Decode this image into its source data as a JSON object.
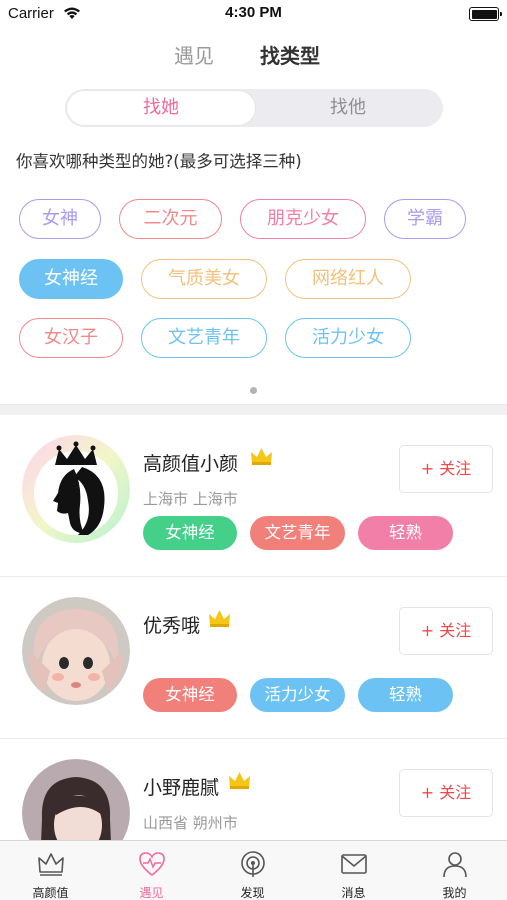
{
  "status_bar": {
    "carrier": "Carrier",
    "time": "4:30 PM"
  },
  "top_tabs": {
    "inactive": "遇见",
    "active": "找类型"
  },
  "segment": {
    "left": "找她",
    "right": "找他"
  },
  "question": "你喜欢哪种类型的她?(最多可选择三种)",
  "type_tags": [
    {
      "label": "女神",
      "color": "#a99cf0",
      "selected": false
    },
    {
      "label": "二次元",
      "color": "#f08a8a",
      "selected": false
    },
    {
      "label": "朋克少女",
      "color": "#f27fa8",
      "selected": false
    },
    {
      "label": "学霸",
      "color": "#a99cf0",
      "selected": false
    },
    {
      "label": "女神经",
      "color": "#6cc3f3",
      "selected": true
    },
    {
      "label": "气质美女",
      "color": "#f1c27d",
      "selected": false
    },
    {
      "label": "网络红人",
      "color": "#f1c27d",
      "selected": false
    },
    {
      "label": "女汉子",
      "color": "#f08a8a",
      "selected": false
    },
    {
      "label": "文艺青年",
      "color": "#6cc3f3",
      "selected": false
    },
    {
      "label": "活力少女",
      "color": "#6cc3f3",
      "selected": false
    }
  ],
  "users": [
    {
      "name": "高颜值小颜",
      "location": "上海市 上海市",
      "follow": "+ 关注",
      "tags": [
        {
          "label": "女神经",
          "color": "#45d08a"
        },
        {
          "label": "文艺青年",
          "color": "#f2807a"
        },
        {
          "label": "轻熟",
          "color": "#f27fa8"
        }
      ]
    },
    {
      "name": "优秀哦",
      "location": "",
      "follow": "+ 关注",
      "tags": [
        {
          "label": "女神经",
          "color": "#f2807a"
        },
        {
          "label": "活力少女",
          "color": "#6cc3f3"
        },
        {
          "label": "轻熟",
          "color": "#6cc3f3"
        }
      ]
    },
    {
      "name": "小野鹿腻",
      "location": "山西省 朔州市",
      "follow": "+ 关注",
      "tags": []
    }
  ],
  "tab_bar": [
    {
      "label": "高颜值",
      "icon": "crown-icon",
      "active": false
    },
    {
      "label": "遇见",
      "icon": "heart-icon",
      "active": true
    },
    {
      "label": "发现",
      "icon": "radar-icon",
      "active": false
    },
    {
      "label": "消息",
      "icon": "mail-icon",
      "active": false
    },
    {
      "label": "我的",
      "icon": "user-icon",
      "active": false
    }
  ],
  "colors": {
    "accent_pink": "#f06a9c",
    "crown_gold": "#f5c518",
    "follow_red": "#ee4a4a"
  }
}
